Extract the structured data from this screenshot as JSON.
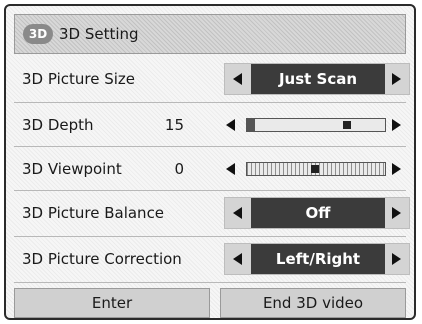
{
  "window": {
    "title": "3D Setting",
    "logo_text": "3D"
  },
  "rows": [
    {
      "label": "3D Picture Size",
      "value": "Just Scan"
    },
    {
      "label": "3D Depth",
      "value": "15"
    },
    {
      "label": "3D Viewpoint",
      "value": "0"
    },
    {
      "label": "3D Picture Balance",
      "value": "Off"
    },
    {
      "label": "3D Picture Correction",
      "value": "Left/Right"
    }
  ],
  "slider_levels": {
    "depth": 15,
    "viewpoint": 0
  },
  "buttons": {
    "enter": "Enter",
    "end_3d": "End 3D video"
  },
  "colors": {
    "selected_bg": "#3b3b3b",
    "selected_text": "#ffffff",
    "panel_bg": "#f6f6f6"
  }
}
